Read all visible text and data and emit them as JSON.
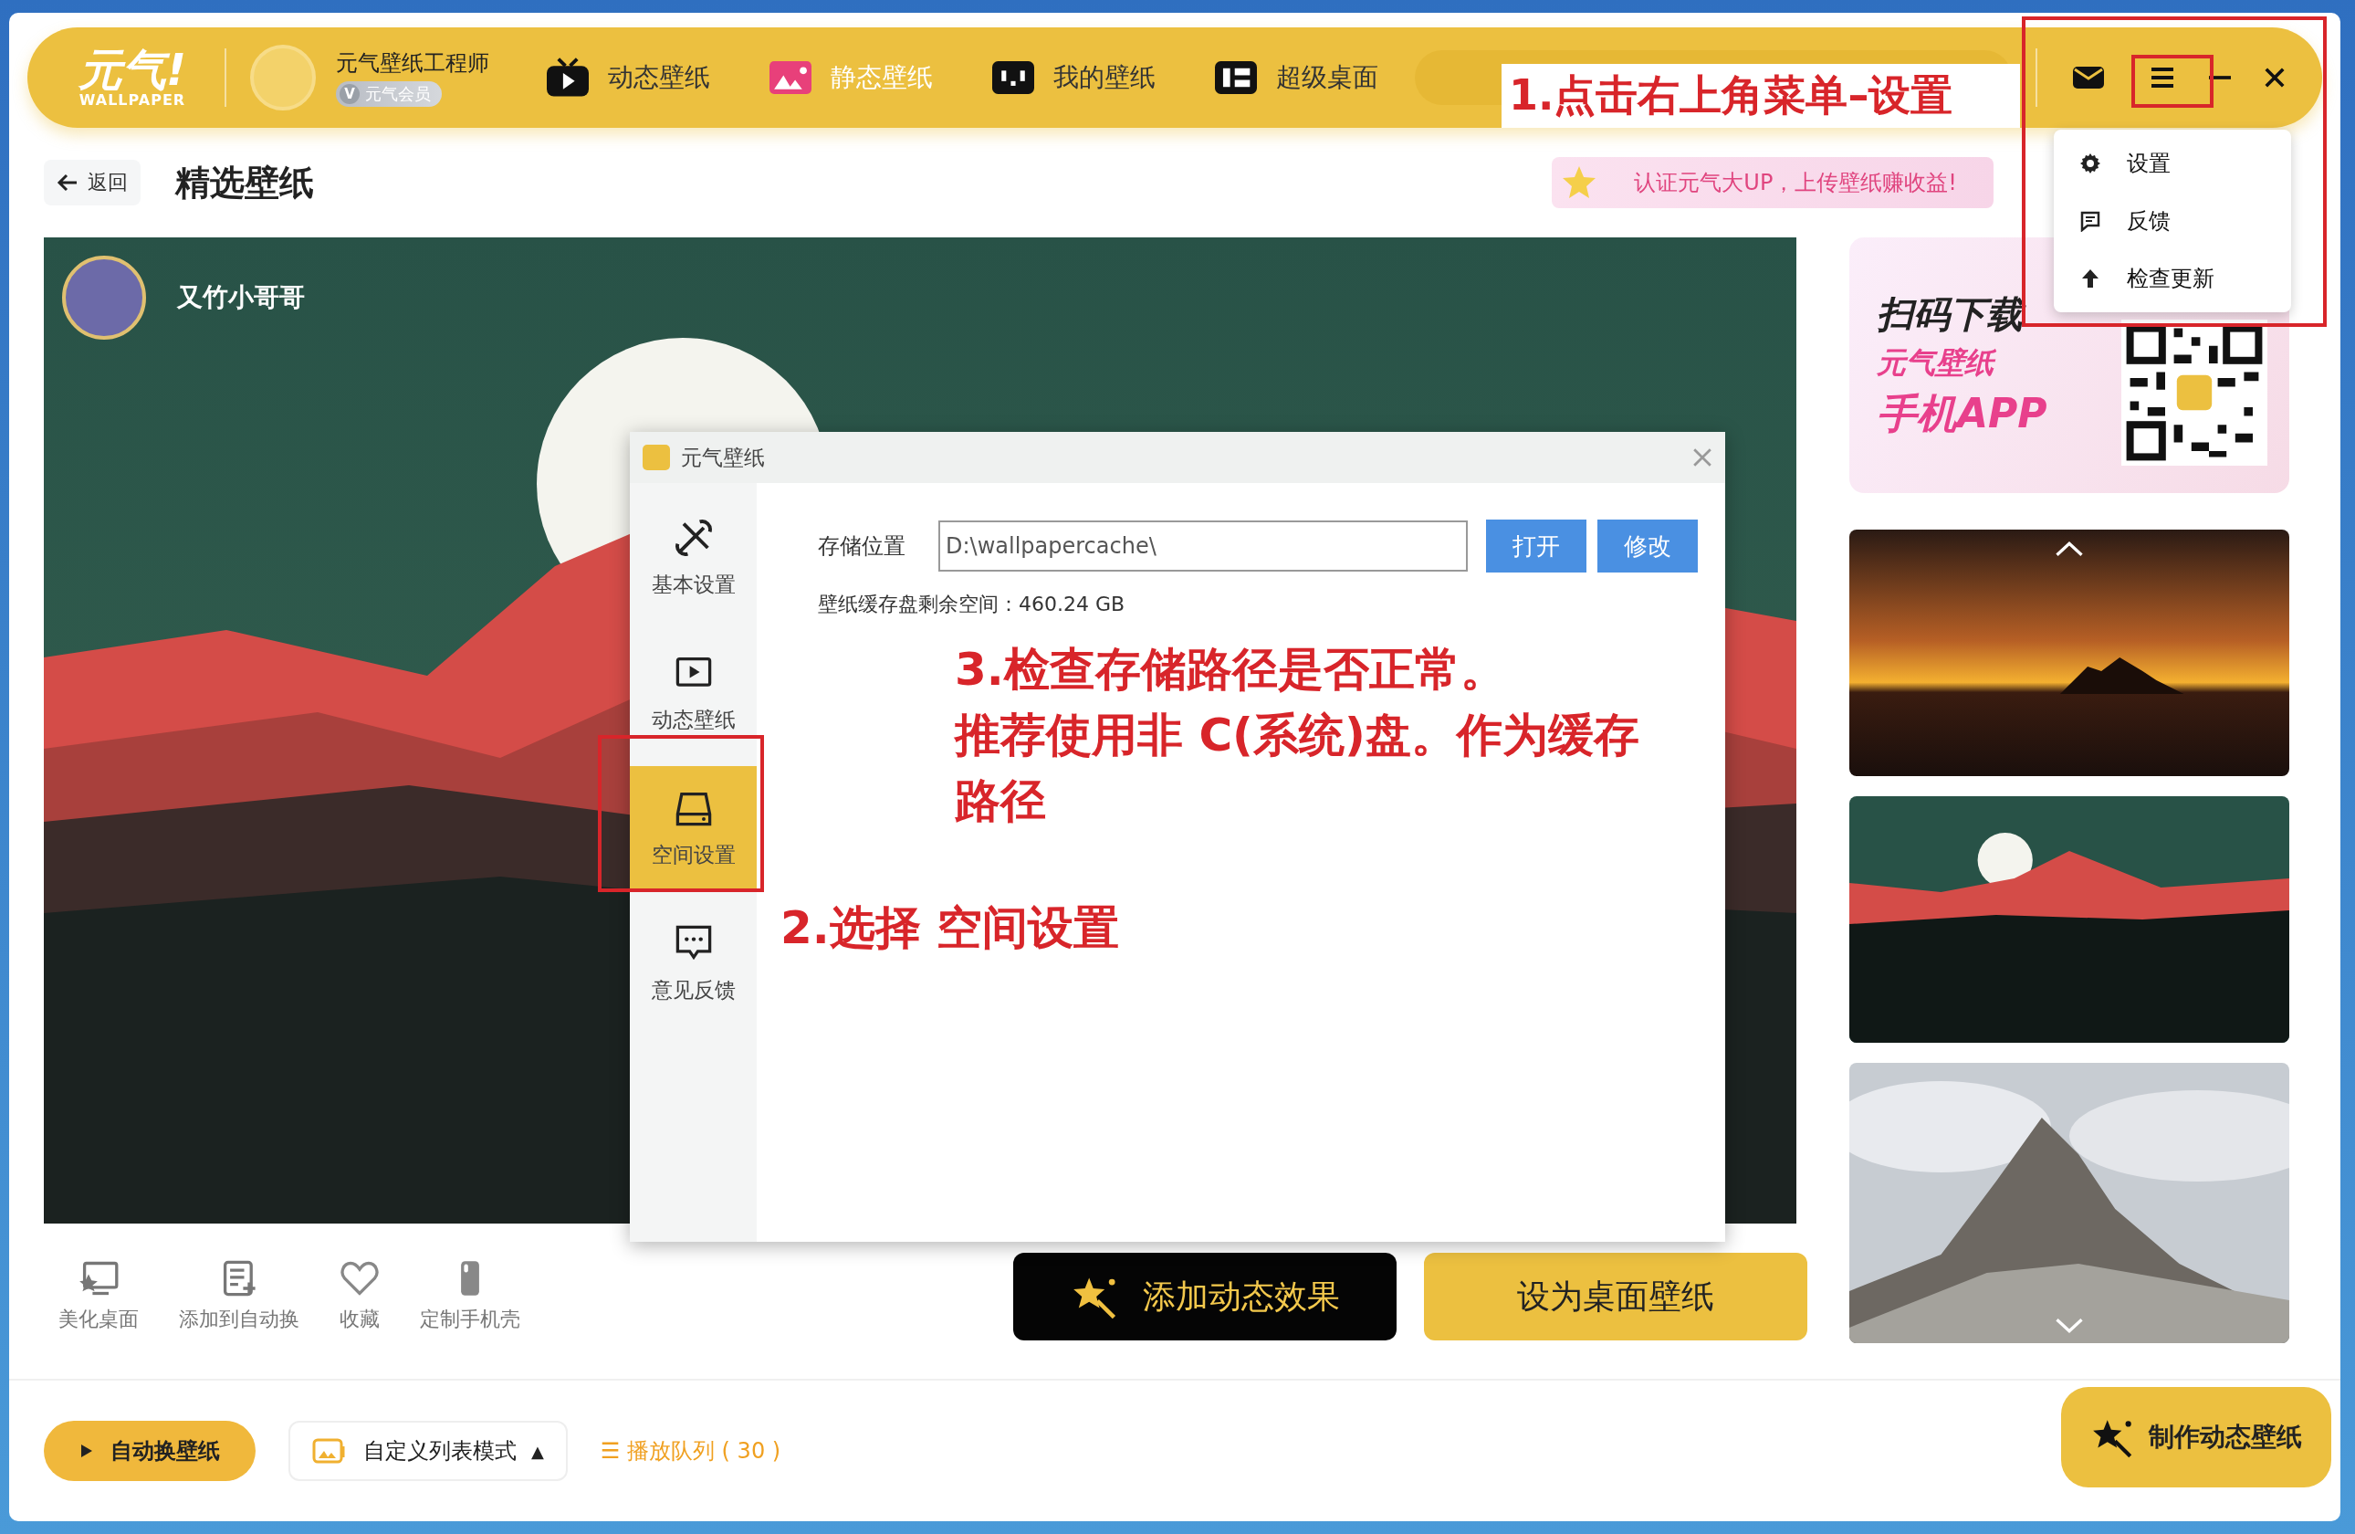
{
  "logo": {
    "mark": "元气!",
    "wordmark": "WALLPAPER"
  },
  "user": {
    "name": "元气壁纸工程师",
    "badge_icon": "V",
    "badge": "元气会员"
  },
  "nav": [
    {
      "label": "动态壁纸",
      "kind": "video"
    },
    {
      "label": "静态壁纸",
      "kind": "image"
    },
    {
      "label": "我的壁纸",
      "kind": "mine"
    },
    {
      "label": "超级桌面",
      "kind": "desktop"
    }
  ],
  "menu": {
    "items": [
      {
        "label": "设置",
        "kind": "gear"
      },
      {
        "label": "反馈",
        "kind": "feedback"
      },
      {
        "label": "检查更新",
        "kind": "update"
      }
    ]
  },
  "header": {
    "back": "返回",
    "title": "精选壁纸",
    "banner": "认证元气大UP，上传壁纸赚收益!"
  },
  "preview": {
    "author": "又竹小哥哥"
  },
  "actions": [
    {
      "label": "美化桌面",
      "kind": "desktop"
    },
    {
      "label": "添加到自动换",
      "kind": "list"
    },
    {
      "label": "收藏",
      "kind": "heart"
    },
    {
      "label": "定制手机壳",
      "kind": "phone"
    }
  ],
  "primary_buttons": [
    {
      "label": "添加动态效果",
      "kind": "effect"
    },
    {
      "label": "设为桌面壁纸",
      "kind": "set"
    }
  ],
  "promo": {
    "title": "扫码下载",
    "line_1": "元气壁纸",
    "line_2": "手机APP"
  },
  "thumbnails": [
    {
      "kind": "sunset"
    },
    {
      "kind": "moon"
    },
    {
      "kind": "peak"
    }
  ],
  "dialog": {
    "title": "元气壁纸",
    "tabs": [
      {
        "label": "基本设置",
        "kind": "tools",
        "selected": false
      },
      {
        "label": "动态壁纸",
        "kind": "video",
        "selected": false
      },
      {
        "label": "空间设置",
        "kind": "disk",
        "selected": true
      },
      {
        "label": "意见反馈",
        "kind": "chat",
        "selected": false
      }
    ],
    "storage_label": "存储位置",
    "storage_path": "D:\\wallpapercache\\",
    "buttons": [
      "打开",
      "修改"
    ],
    "free_space": "壁纸缓存盘剩余空间：460.24 GB"
  },
  "bottom_bar": {
    "auto_switch": "自动换壁纸",
    "mode": "自定义列表模式",
    "caret": "▲",
    "queue_icon": "☰",
    "queue": "播放队列 ( 30 )",
    "create": "制作动态壁纸"
  },
  "annotations": {
    "step_1": "1.点击右上角菜单–设置",
    "step_2": "2.选择 空间设置",
    "step_3": "3.检查存储路径是否正常。",
    "step_3_note": "推荐使用非 C(系统)盘。作为缓存路径"
  }
}
